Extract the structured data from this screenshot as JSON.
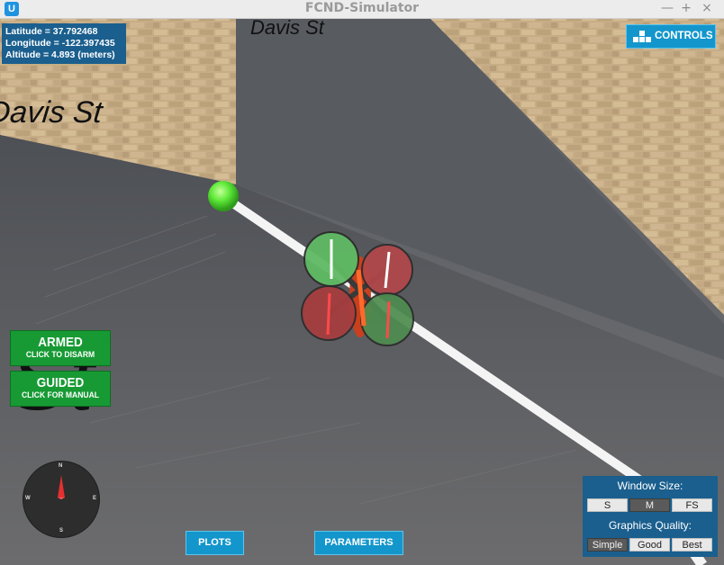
{
  "window": {
    "title": "FCND-Simulator",
    "minimize_glyph": "—",
    "maximize_glyph": "+",
    "close_glyph": "×",
    "app_icon": "udacity-logo-icon"
  },
  "scene": {
    "street_labels": [
      "Davis St",
      "Davis St",
      "St"
    ],
    "waypoint_color": "#5fea3a"
  },
  "gps": {
    "latitude": "Latitude = 37.792468",
    "longitude": "Longitude = -122.397435",
    "altitude": "Altitude = 4.893 (meters)"
  },
  "controls_button": {
    "label": "CONTROLS",
    "icon": "gamepad-icon"
  },
  "armed_button": {
    "title": "ARMED",
    "subtitle": "CLICK TO DISARM"
  },
  "guided_button": {
    "title": "GUIDED",
    "subtitle": "CLICK FOR MANUAL"
  },
  "compass": {
    "north": "N",
    "south": "S",
    "east": "E",
    "west": "W"
  },
  "bottom_buttons": {
    "plots": "PLOTS",
    "parameters": "PARAMETERS"
  },
  "settings": {
    "window_size_label": "Window Size:",
    "window_size_options": [
      "S",
      "M",
      "FS"
    ],
    "window_size_selected": "M",
    "graphics_label": "Graphics Quality:",
    "graphics_options": [
      "Simple",
      "Good",
      "Best"
    ],
    "graphics_selected": "Simple"
  }
}
